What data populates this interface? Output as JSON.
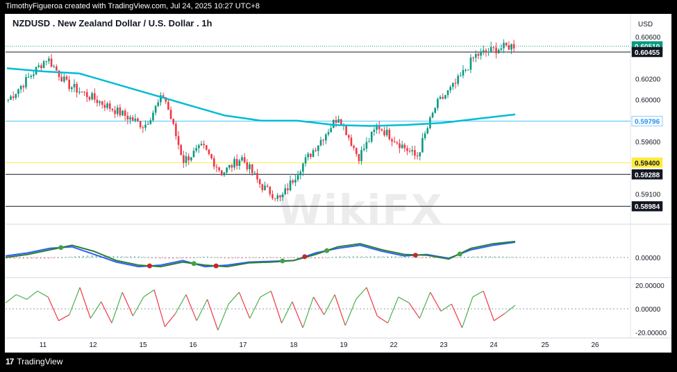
{
  "header": {
    "attribution": "TimothyFigueroa created with TradingView.com, Jul 24, 2025 10:27 UTC+8"
  },
  "chart_title": "NZDUSD . New Zealand Dollar / U.S. Dollar . 1h",
  "footer": {
    "brand": "TradingView",
    "logo": "17"
  },
  "watermark": "WikiFX",
  "chart_data": [
    {
      "type": "candlestick",
      "currency": "USD",
      "ylim": [
        0.5882,
        0.6066
      ],
      "y_ticks": [
        "0.60600",
        "0.60200",
        "0.60000",
        "0.59600",
        "0.59100"
      ],
      "x_ticks": [
        "11",
        "12",
        "15",
        "16",
        "17",
        "18",
        "19",
        "22",
        "23",
        "24",
        "25",
        "26"
      ],
      "price_tags": [
        {
          "label": "0.60510",
          "value": 0.6051,
          "bg": "#089981",
          "fg": "#ffffff"
        },
        {
          "label": "0.60455",
          "value": 0.60455,
          "bg": "#131722",
          "fg": "#ffffff"
        },
        {
          "label": "0.59796",
          "value": 0.59796,
          "bg": "#ffffff",
          "fg": "#2196f3"
        },
        {
          "label": "0.59400",
          "value": 0.594,
          "bg": "#ffeb3b",
          "fg": "#131722"
        },
        {
          "label": "0.59288",
          "value": 0.59288,
          "bg": "#131722",
          "fg": "#ffffff"
        },
        {
          "label": "0.58984",
          "value": 0.58984,
          "bg": "#131722",
          "fg": "#ffffff"
        }
      ],
      "h_lines": [
        {
          "value": 0.60455,
          "color": "#131722"
        },
        {
          "value": 0.59796,
          "color": "#4fc3f7"
        },
        {
          "value": 0.594,
          "color": "#ffeb3b"
        },
        {
          "value": 0.59288,
          "color": "#131722"
        },
        {
          "value": 0.58984,
          "color": "#131722"
        }
      ],
      "close_anchors": [
        0.6,
        0.602,
        0.604,
        0.6015,
        0.6005,
        0.5995,
        0.5985,
        0.5975,
        0.6005,
        0.5942,
        0.5955,
        0.593,
        0.5945,
        0.5918,
        0.5905,
        0.5935,
        0.596,
        0.5985,
        0.5945,
        0.5975,
        0.596,
        0.5945,
        0.5995,
        0.6015,
        0.6042,
        0.6048,
        0.6052
      ],
      "sma": [
        0.603,
        0.6027,
        0.6025,
        0.6015,
        0.6005,
        0.5995,
        0.5985,
        0.598,
        0.598,
        0.5976,
        0.5975,
        0.5976,
        0.5978,
        0.5982,
        0.5986
      ],
      "bullish_color": "#089981",
      "bearish_color": "#f23645",
      "sma_color": "#00bcd4"
    },
    {
      "type": "line",
      "name": "macd",
      "zero_label": "0.00000",
      "series": [
        {
          "values": [
            0.1,
            0.3,
            0.6,
            0.7,
            0.2,
            -0.3,
            -0.6,
            -0.5,
            -0.2,
            -0.6,
            -0.5,
            -0.3,
            -0.25,
            -0.2,
            0.3,
            0.6,
            0.8,
            0.4,
            0.1,
            0.2,
            -0.05,
            0.5,
            0.8,
            1.0
          ],
          "color": "#2962ff"
        },
        {
          "values": [
            0.0,
            0.2,
            0.5,
            0.8,
            0.4,
            -0.2,
            -0.5,
            -0.6,
            -0.3,
            -0.5,
            -0.6,
            -0.35,
            -0.3,
            -0.2,
            0.2,
            0.7,
            0.9,
            0.5,
            0.2,
            0.15,
            -0.1,
            0.6,
            0.9,
            1.05
          ],
          "color": "#2e7d32"
        }
      ]
    },
    {
      "type": "line",
      "name": "oscillator",
      "y_ticks": [
        "20.00000",
        "0.00000",
        "-20.00000"
      ],
      "ylim": [
        -24,
        24
      ],
      "values": [
        5,
        12,
        8,
        15,
        10,
        -10,
        -5,
        18,
        -8,
        6,
        -12,
        14,
        -6,
        10,
        16,
        -15,
        -4,
        12,
        -10,
        8,
        -18,
        4,
        14,
        -8,
        10,
        15,
        -12,
        6,
        -16,
        10,
        -5,
        12,
        -14,
        8,
        18,
        -6,
        -12,
        10,
        5,
        -8,
        14,
        -2,
        4,
        -16,
        10,
        15,
        -10,
        -4,
        3
      ],
      "up_color": "#4caf50",
      "down_color": "#f23645"
    }
  ]
}
